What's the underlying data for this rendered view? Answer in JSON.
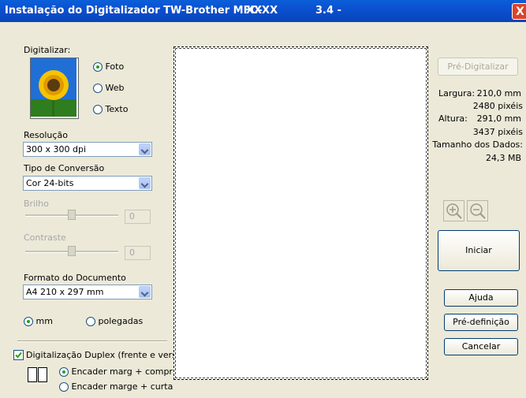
{
  "window": {
    "title": "Instalação do Digitalizador TW-Brother MFC-",
    "model_code": "XXXX",
    "version": "3.4 -",
    "close_label": "X"
  },
  "scan": {
    "label": "Digitalizar:",
    "options": [
      {
        "label": "Foto",
        "selected": true
      },
      {
        "label": "Web",
        "selected": false
      },
      {
        "label": "Texto",
        "selected": false
      }
    ]
  },
  "resolution": {
    "label": "Resolução",
    "value": "300 x 300 dpi"
  },
  "conversion": {
    "label": "Tipo de Conversão",
    "value": "Cor 24-bits"
  },
  "brightness": {
    "label": "Brilho",
    "value": "0"
  },
  "contrast": {
    "label": "Contraste",
    "value": "0"
  },
  "doc_size": {
    "label": "Formato do Documento",
    "value": "A4 210 x 297 mm"
  },
  "units": [
    {
      "label": "mm",
      "selected": true
    },
    {
      "label": "polegadas",
      "selected": false
    }
  ],
  "duplex": {
    "label": "Digitalização Duplex (frente e verso)",
    "checked": true,
    "options": [
      {
        "label": "Encader marg + compri",
        "selected": true
      },
      {
        "label": "Encader marge + curta",
        "selected": false
      }
    ]
  },
  "info": {
    "prescan_label": "Pré-Digitalizar",
    "width_label": "Largura:",
    "width_mm": "210,0 mm",
    "width_px": "2480 pixéis",
    "height_label": "Altura:",
    "height_mm": "291,0 mm",
    "height_px": "3437 pixéis",
    "size_label": "Tamanho dos Dados:",
    "size_value": "24,3 MB"
  },
  "buttons": {
    "start": "Iniciar",
    "help": "Ajuda",
    "default": "Pré-definição",
    "cancel": "Cancelar"
  },
  "icons": [
    "sunflower-photo-icon",
    "zoom-in-icon",
    "zoom-out-icon",
    "duplex-binding-icon",
    "close-icon"
  ]
}
